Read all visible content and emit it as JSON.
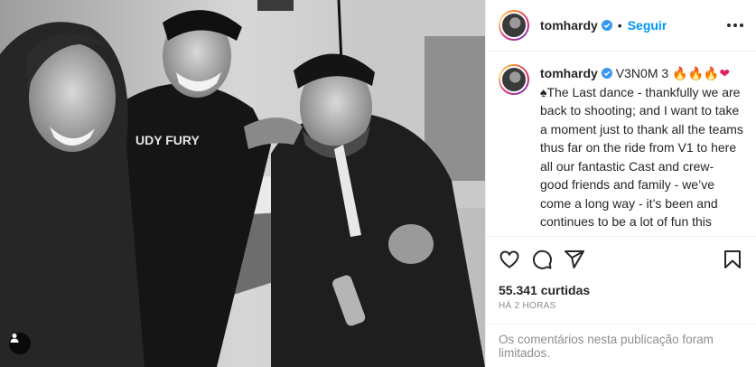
{
  "header": {
    "username": "tomhardy",
    "separator": "•",
    "follow_label": "Seguir",
    "more_icon": "more-horizontal-icon"
  },
  "caption": {
    "username": "tomhardy",
    "title": "V3N0M 3",
    "emojis": [
      "🔥",
      "🔥",
      "🔥",
      "❤"
    ],
    "body": "♠The Last dance - thankfully we are back to shooting; and I want to take a moment just to thank all the teams thus far on the ride from V1 to here all our fantastic Cast and crew- good friends and family - we’ve come a long way - it’s been and continues to be a lot of fun this journey there’s always hard turns to burn when we work but doesn’t feel as hard when you love what you do and when you"
  },
  "actions": {
    "icons": [
      "heart-icon",
      "comment-icon",
      "share-icon",
      "bookmark-icon"
    ]
  },
  "likes": "55.341 curtidas",
  "timestamp": "HÁ 2 HORAS",
  "comments_notice": "Os comentários nesta publicação foram limitados.",
  "colors": {
    "link": "#0095f6",
    "verified": "#3897f0",
    "muted": "#8e8e8e"
  }
}
